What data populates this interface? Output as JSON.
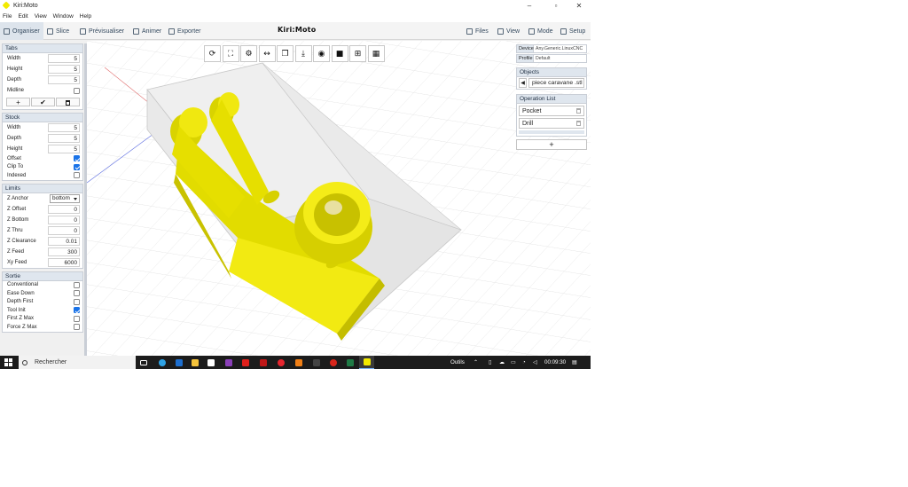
{
  "window": {
    "title": "Kiri:Moto"
  },
  "menubar": [
    "File",
    "Edit",
    "View",
    "Window",
    "Help"
  ],
  "topbar": {
    "left_tabs": [
      {
        "label": "Organiser",
        "icon": "arrange-icon"
      },
      {
        "label": "Slice",
        "icon": "slice-icon"
      },
      {
        "label": "Prévisualiser",
        "icon": "preview-icon"
      },
      {
        "label": "Animer",
        "icon": "animate-icon"
      },
      {
        "label": "Exporter",
        "icon": "export-icon"
      }
    ],
    "brand": "Kiri:Moto",
    "right_tabs": [
      {
        "label": "Files",
        "icon": "folder-icon"
      },
      {
        "label": "View",
        "icon": "eye-icon"
      },
      {
        "label": "Mode",
        "icon": "mode-icon"
      },
      {
        "label": "Setup",
        "icon": "gear-icon"
      }
    ]
  },
  "left": {
    "tabs": {
      "title": "Tabs",
      "fields": [
        {
          "label": "Width",
          "value": "5"
        },
        {
          "label": "Height",
          "value": "5"
        },
        {
          "label": "Depth",
          "value": "5"
        }
      ],
      "midline": {
        "label": "Midline",
        "checked": false
      },
      "buttons": [
        "+",
        "✔",
        "🗑"
      ]
    },
    "stock": {
      "title": "Stock",
      "fields": [
        {
          "label": "Width",
          "value": "5"
        },
        {
          "label": "Depth",
          "value": "5"
        },
        {
          "label": "Height",
          "value": "5"
        }
      ],
      "checks": [
        {
          "label": "Offset",
          "checked": true
        },
        {
          "label": "Clip To",
          "checked": true
        },
        {
          "label": "Indexed",
          "checked": false
        }
      ]
    },
    "limits": {
      "title": "Limits",
      "z_anchor": {
        "label": "Z Anchor",
        "value": "bottom"
      },
      "fields": [
        {
          "label": "Z Offset",
          "value": "0"
        },
        {
          "label": "Z Bottom",
          "value": "0"
        },
        {
          "label": "Z Thru",
          "value": "0"
        },
        {
          "label": "Z Clearance",
          "value": "0.01"
        },
        {
          "label": "Z Feed",
          "value": "300"
        },
        {
          "label": "Xy Feed",
          "value": "6000"
        }
      ]
    },
    "sortie": {
      "title": "Sortie",
      "checks": [
        {
          "label": "Conventional",
          "checked": false
        },
        {
          "label": "Ease Down",
          "checked": false
        },
        {
          "label": "Depth First",
          "checked": false
        },
        {
          "label": "Tool Init",
          "checked": true
        },
        {
          "label": "First Z Max",
          "checked": false
        },
        {
          "label": "Force Z Max",
          "checked": false
        }
      ]
    }
  },
  "right": {
    "device": {
      "label": "Device",
      "value": "Any.Generic.LinuxCNC"
    },
    "profile": {
      "label": "Profile",
      "value": "Default"
    },
    "objects": {
      "title": "Objects",
      "selected": "piece caravane .stl"
    },
    "operations": {
      "title": "Operation List",
      "items": [
        "Pocket",
        "Drill"
      ],
      "add": "+"
    }
  },
  "viewport_toolbar": [
    {
      "name": "rotate-icon",
      "glyph": "⟳"
    },
    {
      "name": "fit-screen-icon",
      "glyph": "⛶"
    },
    {
      "name": "layout-icon",
      "glyph": "⚙"
    },
    {
      "name": "scale-icon",
      "glyph": "↔"
    },
    {
      "name": "duplicate-icon",
      "glyph": "❐"
    },
    {
      "name": "lay-flat-icon",
      "glyph": "⤓"
    },
    {
      "name": "visibility-icon",
      "glyph": "◉"
    },
    {
      "name": "solid-icon",
      "glyph": "■"
    },
    {
      "name": "grid-icon",
      "glyph": "⊞"
    },
    {
      "name": "grid-fine-icon",
      "glyph": "▦"
    }
  ],
  "taskbar": {
    "search_placeholder": "Rechercher",
    "tray_label": "Outils",
    "clock": "00:09:30"
  },
  "colors": {
    "accent": "#1a73e8",
    "model": "#f2ea00",
    "panel_header": "#dfe6ee"
  }
}
